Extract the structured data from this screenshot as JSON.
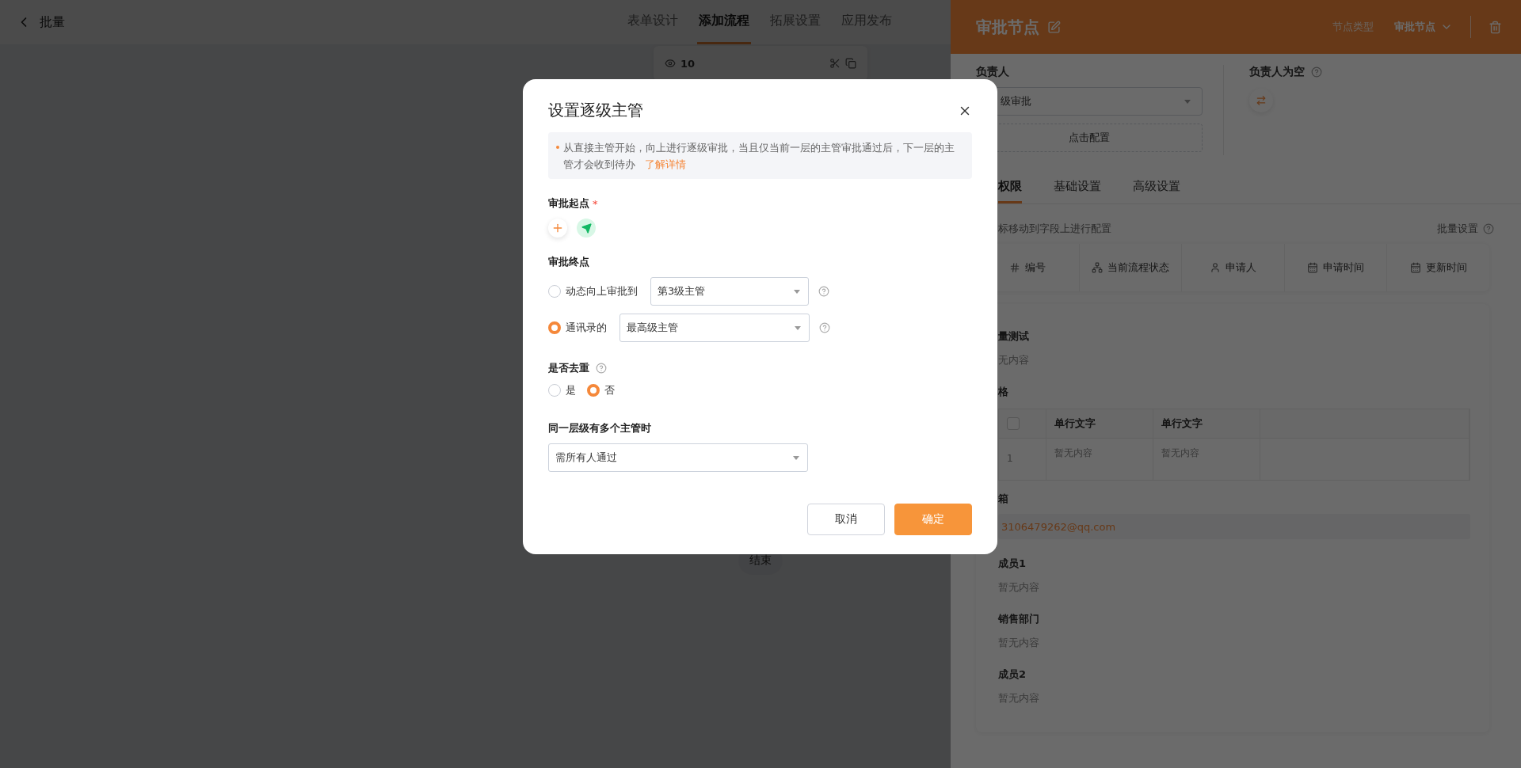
{
  "top_bar": {
    "back_label": "批量",
    "tabs": [
      {
        "label": "表单设计",
        "selected": false
      },
      {
        "label": "添加流程",
        "selected": true
      },
      {
        "label": "拓展设置",
        "selected": false
      },
      {
        "label": "应用发布",
        "selected": false
      }
    ]
  },
  "canvas": {
    "node_count": "10",
    "end_node": "结束"
  },
  "drawer": {
    "title": "审批节点",
    "node_type_label": "节点类型",
    "node_type_value": "审批节点",
    "assignee": {
      "label": "负责人",
      "select_value": "级审批",
      "config_button": "点击配置"
    },
    "empty_assignee": {
      "label": "负责人为空"
    },
    "tabs": [
      {
        "label": "权限",
        "selected": true
      },
      {
        "label": "基础设置",
        "selected": false
      },
      {
        "label": "高级设置",
        "selected": false
      }
    ],
    "hint": "标移动到字段上进行配置",
    "batch_settings": "批量设置",
    "field_chips": [
      {
        "label": "编号",
        "kind": "hash"
      },
      {
        "label": "当前流程状态",
        "kind": "flow"
      },
      {
        "label": "申请人",
        "kind": "person"
      },
      {
        "label": "申请时间",
        "kind": "calendar"
      },
      {
        "label": "更新时间",
        "kind": "calendar"
      }
    ],
    "fields": [
      {
        "kind": "text",
        "label": "量测试",
        "value": "无内容"
      },
      {
        "kind": "table",
        "label": "格",
        "checked": false,
        "columns": [
          "单行文字",
          "单行文字"
        ],
        "rows": [
          {
            "index": "1",
            "cells": [
              "暂无内容",
              "暂无内容"
            ]
          }
        ]
      },
      {
        "kind": "email",
        "label": "箱",
        "value": "3106479262@qq.com"
      },
      {
        "kind": "text",
        "label": "成员1",
        "value": "暂无内容"
      },
      {
        "kind": "text",
        "label": "销售部门",
        "value": "暂无内容"
      },
      {
        "kind": "text",
        "label": "成员2",
        "value": "暂无内容"
      }
    ]
  },
  "dialog": {
    "title": "设置逐级主管",
    "notice": "从直接主管开始，向上进行逐级审批，当且仅当前一层的主管审批通过后，下一层的主管才会收到待办",
    "notice_link": "了解详情",
    "start": {
      "label": "审批起点",
      "required_mark": "*"
    },
    "end": {
      "label": "审批终点",
      "options": [
        {
          "label": "动态向上审批到",
          "selected": false,
          "select_value": "第3级主管"
        },
        {
          "label": "通讯录的",
          "selected": true,
          "select_value": "最高级主管"
        }
      ]
    },
    "dedupe": {
      "label": "是否去重",
      "options": [
        {
          "label": "是",
          "selected": false
        },
        {
          "label": "否",
          "selected": true
        }
      ]
    },
    "multi": {
      "label": "同一层级有多个主管时",
      "select_value": "需所有人通过"
    },
    "buttons": [
      {
        "label": "取消",
        "kind": "secondary"
      },
      {
        "label": "确定",
        "kind": "primary"
      }
    ]
  }
}
